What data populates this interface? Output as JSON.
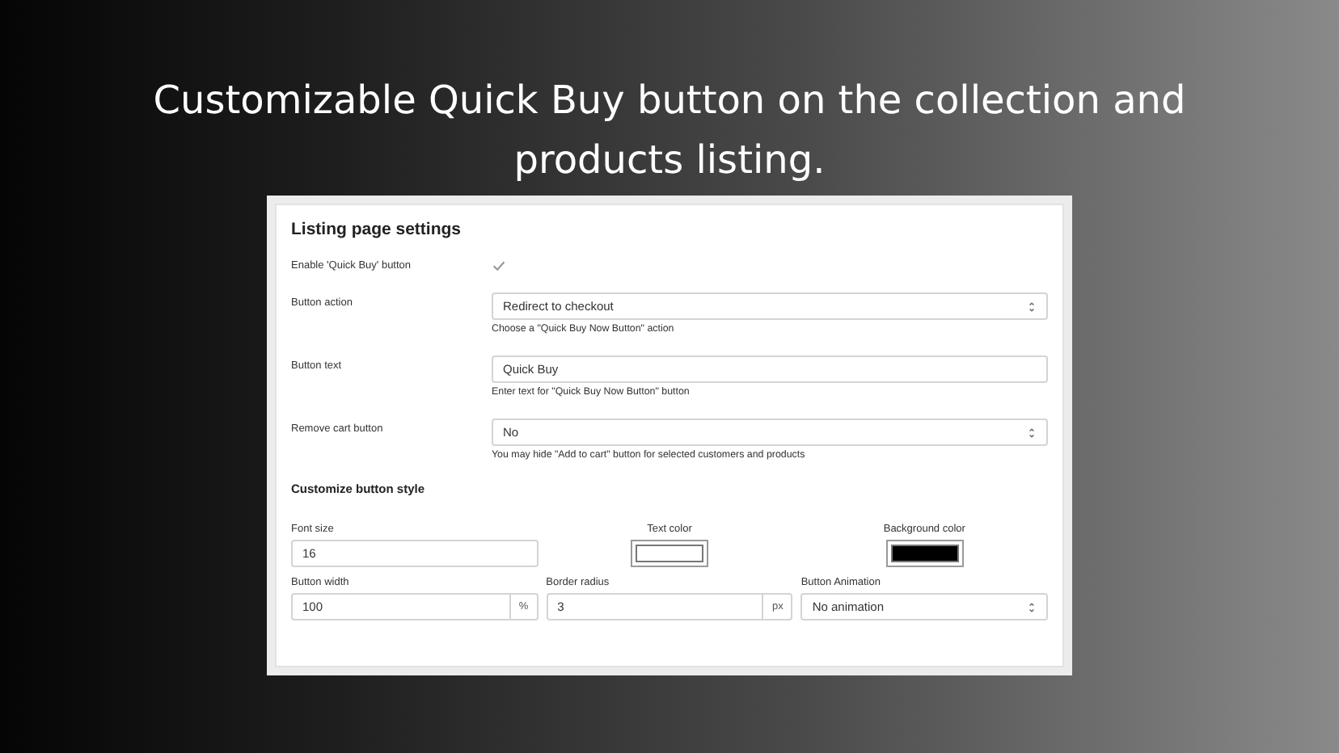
{
  "headline": "Customizable Quick Buy button on the collection and products listing.",
  "panel": {
    "title": "Listing page settings",
    "settings": [
      {
        "kind": "checkbox",
        "label": "Enable 'Quick Buy' button",
        "checked": true
      },
      {
        "kind": "select",
        "label": "Button action",
        "value": "Redirect to checkout",
        "hint": "Choose a \"Quick Buy Now Button\" action"
      },
      {
        "kind": "text",
        "label": "Button text",
        "value": "Quick Buy",
        "hint": "Enter text for \"Quick Buy Now Button\" button"
      },
      {
        "kind": "select",
        "label": "Remove cart button",
        "value": "No",
        "hint": "You may hide \"Add to cart\" button for selected customers and products"
      }
    ],
    "style_title": "Customize button style",
    "style_fields": [
      {
        "kind": "text",
        "label": "Font size",
        "value": "16"
      },
      {
        "kind": "color",
        "label": "Text color",
        "color": "#ffffff"
      },
      {
        "kind": "color",
        "label": "Background color",
        "color": "#000000"
      },
      {
        "kind": "unit",
        "label": "Button width",
        "value": "100",
        "unit": "%"
      },
      {
        "kind": "unit",
        "label": "Border radius",
        "value": "3",
        "unit": "px"
      },
      {
        "kind": "select",
        "label": "Button Animation",
        "value": "No animation"
      }
    ]
  }
}
